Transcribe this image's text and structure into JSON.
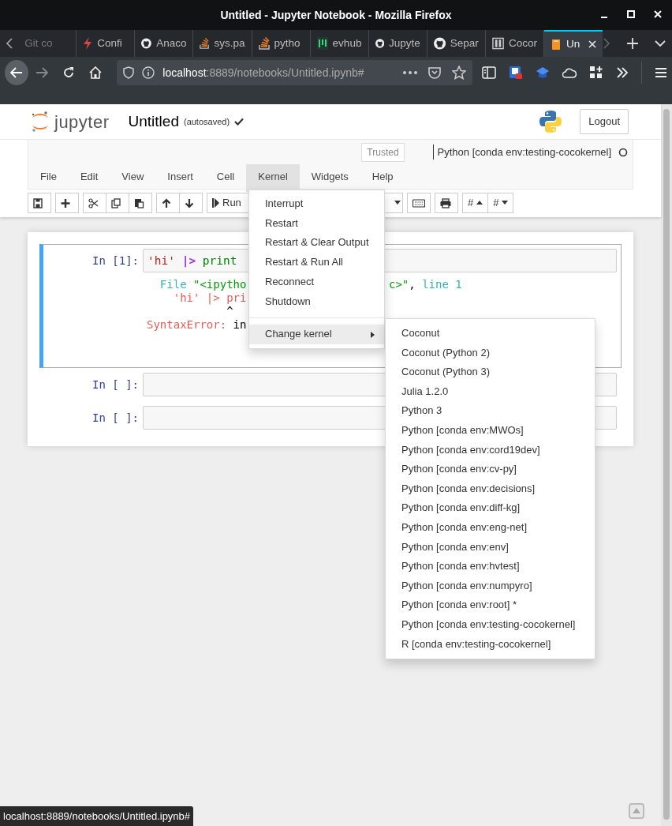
{
  "window": {
    "title": "Untitled - Jupyter Notebook - Mozilla Firefox"
  },
  "browser_tabs": [
    {
      "label": "Git co",
      "kind": "none",
      "selected": false
    },
    {
      "label": "Confi",
      "kind": "bolt",
      "selected": false
    },
    {
      "label": "Anaco",
      "kind": "github",
      "selected": false
    },
    {
      "label": "sys.pa",
      "kind": "stack",
      "selected": false
    },
    {
      "label": "pytho",
      "kind": "stack",
      "selected": false
    },
    {
      "label": "evhub",
      "kind": "bars",
      "selected": false
    },
    {
      "label": "Jupyte",
      "kind": "github",
      "selected": false
    },
    {
      "label": "Separ",
      "kind": "github",
      "selected": false
    },
    {
      "label": "Cocor",
      "kind": "columns",
      "selected": false
    },
    {
      "label": "Un",
      "kind": "book",
      "selected": true
    }
  ],
  "address_bar": {
    "host": "localhost",
    "path": ":8889/notebooks/Untitled.ipynb#"
  },
  "notebook": {
    "logo_text": "jupyter",
    "name": "Untitled",
    "save_status": "(autosaved)",
    "logout": "Logout",
    "trusted": "Trusted",
    "kernel_name": "Python [conda env:testing-cocokernel]",
    "kernel_busy": false
  },
  "menu": [
    {
      "label": "File",
      "selected": false
    },
    {
      "label": "Edit",
      "selected": false
    },
    {
      "label": "View",
      "selected": false
    },
    {
      "label": "Insert",
      "selected": false
    },
    {
      "label": "Cell",
      "selected": false
    },
    {
      "label": "Kernel",
      "selected": true
    },
    {
      "label": "Widgets",
      "selected": false
    },
    {
      "label": "Help",
      "selected": false
    }
  ],
  "toolbar_groups": [
    [
      {
        "kind": "save"
      }
    ],
    [
      {
        "kind": "insert"
      }
    ],
    [
      {
        "kind": "cut"
      },
      {
        "kind": "copy"
      },
      {
        "kind": "paste"
      }
    ],
    [
      {
        "kind": "up"
      },
      {
        "kind": "down"
      }
    ],
    [
      {
        "kind": "run",
        "label": "Run"
      }
    ],
    [
      {
        "kind": "select"
      }
    ],
    [
      {
        "kind": "keyboard"
      }
    ],
    [
      {
        "kind": "print"
      }
    ],
    [
      {
        "kind": "sort-up",
        "label": "#"
      },
      {
        "kind": "sort-down",
        "label": "#"
      }
    ]
  ],
  "cells": [
    {
      "prompt": "In [1]:",
      "selected": true,
      "code": [
        {
          "text": "'hi'",
          "kind": "string"
        },
        {
          "text": "|>",
          "kind": "operator"
        },
        {
          "text": "print",
          "kind": "builtin"
        }
      ],
      "output": [
        {
          "segments": [
            {
              "text": "  File",
              "kind": "label"
            },
            {
              "text": " \"<ipytho",
              "kind": "path"
            }
          ],
          "tail": [
            {
              "text": "c>\"",
              "kind": "path"
            },
            {
              "text": ", ",
              "kind": "plain"
            },
            {
              "text": "line 1",
              "kind": "label"
            }
          ]
        },
        {
          "segments": [
            {
              "text": "    'hi' |> pri",
              "kind": "error"
            }
          ]
        },
        {
          "segments": [
            {
              "text": "            ^",
              "kind": "plain"
            }
          ]
        },
        {
          "segments": [
            {
              "text": "SyntaxError:",
              "kind": "error"
            },
            {
              "text": " in",
              "kind": "plain"
            }
          ]
        }
      ]
    },
    {
      "prompt": "In [ ]:",
      "selected": false
    },
    {
      "prompt": "In [ ]:",
      "selected": false
    }
  ],
  "kernel_menu": [
    {
      "kind": "command",
      "label": "Interrupt"
    },
    {
      "kind": "command",
      "label": "Restart"
    },
    {
      "kind": "command",
      "label": "Restart & Clear Output"
    },
    {
      "kind": "command",
      "label": "Restart & Run All"
    },
    {
      "kind": "command",
      "label": "Reconnect"
    },
    {
      "kind": "command",
      "label": "Shutdown"
    },
    {
      "kind": "divider"
    },
    {
      "kind": "submenu",
      "label": "Change kernel",
      "expanded": true,
      "items": [
        "Coconut",
        "Coconut (Python 2)",
        "Coconut (Python 3)",
        "Julia 1.2.0",
        "Python 3",
        "Python [conda env:MWOs]",
        "Python [conda env:cord19dev]",
        "Python [conda env:cv-py]",
        "Python [conda env:decisions]",
        "Python [conda env:diff-kg]",
        "Python [conda env:eng-net]",
        "Python [conda env:env]",
        "Python [conda env:hvtest]",
        "Python [conda env:numpyro]",
        "Python [conda env:root] *",
        "Python [conda env:testing-cocokernel]",
        "R [conda env:testing-cocokernel]"
      ]
    }
  ],
  "status_link": "localhost:8889/notebooks/Untitled.ipynb#"
}
